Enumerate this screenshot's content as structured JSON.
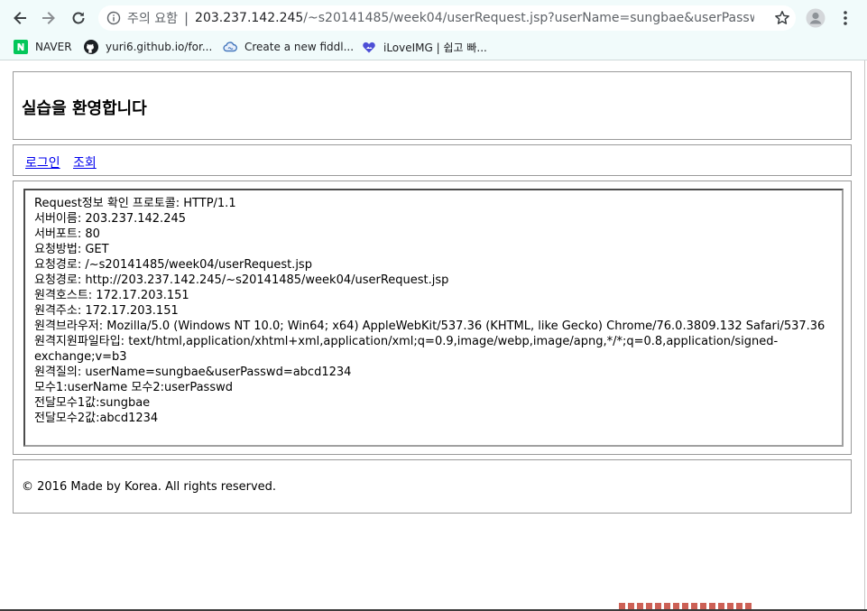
{
  "browser": {
    "security_label": "주의 요함",
    "url_host": "203.237.142.245",
    "url_path": "/~s20141485/week04/userRequest.jsp?userName=sungbae&userPasswd=abcd1...",
    "bookmarks": [
      {
        "label": "NAVER",
        "icon": "naver-icon"
      },
      {
        "label": "yuri6.github.io/for...",
        "icon": "github-icon"
      },
      {
        "label": "Create a new fiddl...",
        "icon": "jsfiddle-icon"
      },
      {
        "label": "iLoveIMG | 쉽고 빠...",
        "icon": "iloveimg-icon"
      }
    ],
    "colors": {
      "toolbar_bg": "#f1fbfb",
      "link": "#0000ee",
      "naver_green": "#03c75a"
    }
  },
  "page": {
    "header_title": "실습을 환영합니다",
    "nav_links": [
      "로그인",
      "조회"
    ],
    "info_lines": [
      "Request정보 확인 프로토콜: HTTP/1.1",
      "서버이름: 203.237.142.245",
      "서버포트: 80",
      "요청방법: GET",
      "요청경로: /~s20141485/week04/userRequest.jsp",
      "요청경로: http://203.237.142.245/~s20141485/week04/userRequest.jsp",
      "원격호스트: 172.17.203.151",
      "원격주소: 172.17.203.151",
      "원격브라우저: Mozilla/5.0 (Windows NT 10.0; Win64; x64) AppleWebKit/537.36 (KHTML, like Gecko) Chrome/76.0.3809.132 Safari/537.36",
      "원격지원파일타입: text/html,application/xhtml+xml,application/xml;q=0.9,image/webp,image/apng,*/*;q=0.8,application/signed-exchange;v=b3",
      "원격질의: userName=sungbae&userPasswd=abcd1234",
      "모수1:userName 모수2:userPasswd",
      "전달모수1값:sungbae",
      "전달모수2값:abcd1234"
    ],
    "footer_text": "© 2016 Made by Korea. All rights reserved."
  }
}
